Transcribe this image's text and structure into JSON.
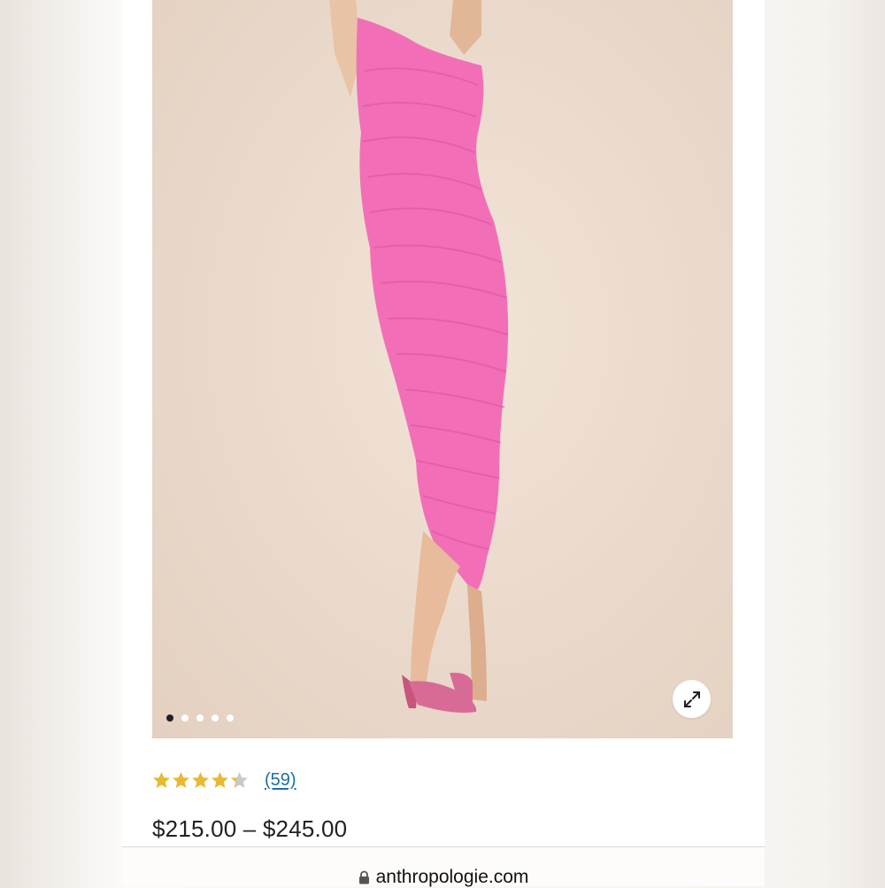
{
  "product": {
    "image_alt": "Model wearing a pink one-shoulder ruched midi dress with pink heeled sandals",
    "carousel": {
      "count": 5,
      "active_index": 0
    },
    "expand_icon": "expand-arrows-icon"
  },
  "rating": {
    "stars_value": 4.3,
    "stars_max": 5,
    "review_count": "(59)",
    "colors": {
      "filled": "#e8b931",
      "empty": "#c9c9c9"
    }
  },
  "price": {
    "range": "$215.00 – $245.00"
  },
  "browser": {
    "url": "anthropologie.com",
    "lock_icon": "lock-icon"
  },
  "colors": {
    "dress": "#f26fb8",
    "review_link": "#1d6fa0"
  }
}
